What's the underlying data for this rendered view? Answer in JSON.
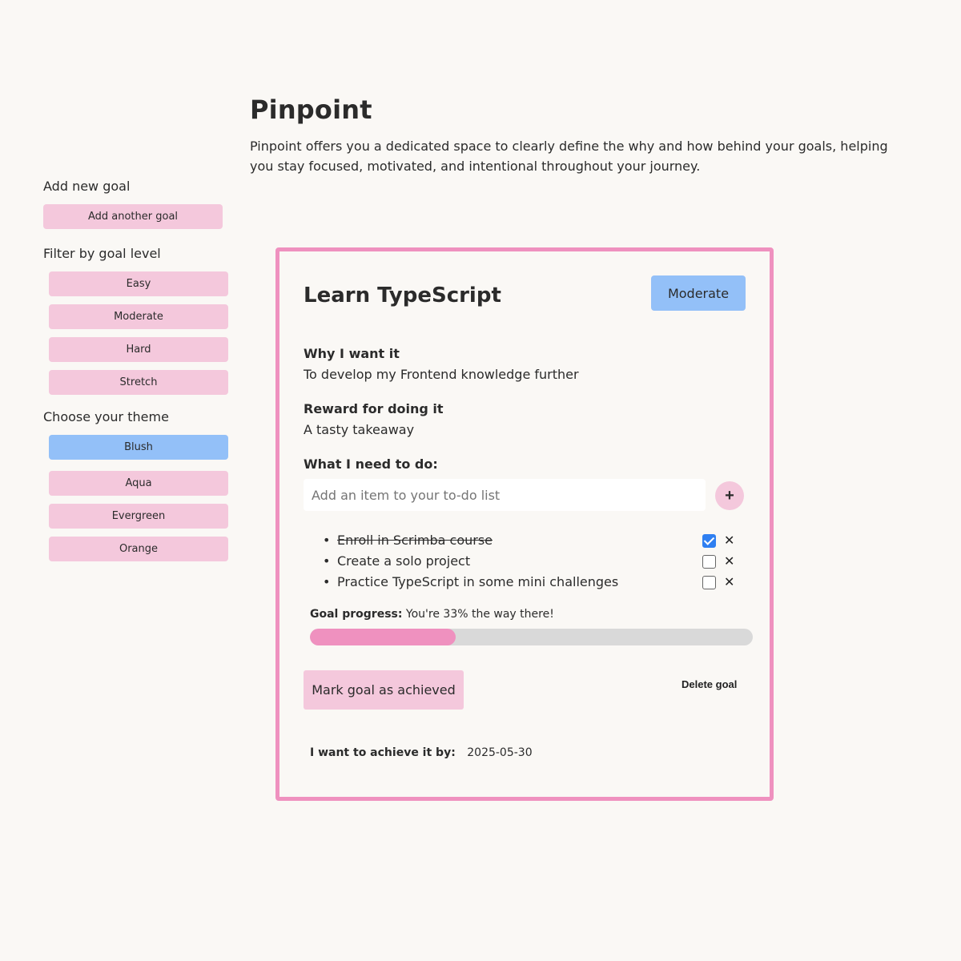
{
  "header": {
    "title": "Pinpoint",
    "description": "Pinpoint offers you a dedicated space to clearly define the why and how behind your goals, helping you stay focused, motivated, and intentional throughout your journey."
  },
  "sidebar": {
    "add_heading": "Add new goal",
    "add_button": "Add another goal",
    "filter_heading": "Filter by goal level",
    "levels": [
      "Easy",
      "Moderate",
      "Hard",
      "Stretch"
    ],
    "theme_heading": "Choose your theme",
    "themes": [
      "Blush",
      "Aqua",
      "Evergreen",
      "Orange"
    ],
    "active_theme": "Blush"
  },
  "goal": {
    "title": "Learn TypeScript",
    "level": "Moderate",
    "why_label": "Why I want it",
    "why_value": "To develop my Frontend knowledge further",
    "reward_label": "Reward for doing it",
    "reward_value": "A tasty takeaway",
    "todo_label": "What I need to do:",
    "todo_placeholder": "Add an item to your to-do list",
    "add_item_symbol": "+",
    "todos": [
      {
        "text": "Enroll in Scrimba course",
        "done": true
      },
      {
        "text": "Create a solo project",
        "done": false
      },
      {
        "text": "Practice TypeScript in some mini challenges",
        "done": false
      }
    ],
    "delete_symbol": "✕",
    "progress_label": "Goal progress:",
    "progress_text": "You're 33% the way there!",
    "progress_percent": 33,
    "achieve_button": "Mark goal as achieved",
    "delete_button": "Delete goal",
    "deadline_label": "I want to achieve it by:",
    "deadline_value": "2025-05-30"
  },
  "colors": {
    "background": "#faf8f5",
    "accent_pink": "#ef91bf",
    "button_pink": "#f4c8dc",
    "active_blue": "#93c0f8",
    "checkbox_blue": "#2f7ff1"
  }
}
